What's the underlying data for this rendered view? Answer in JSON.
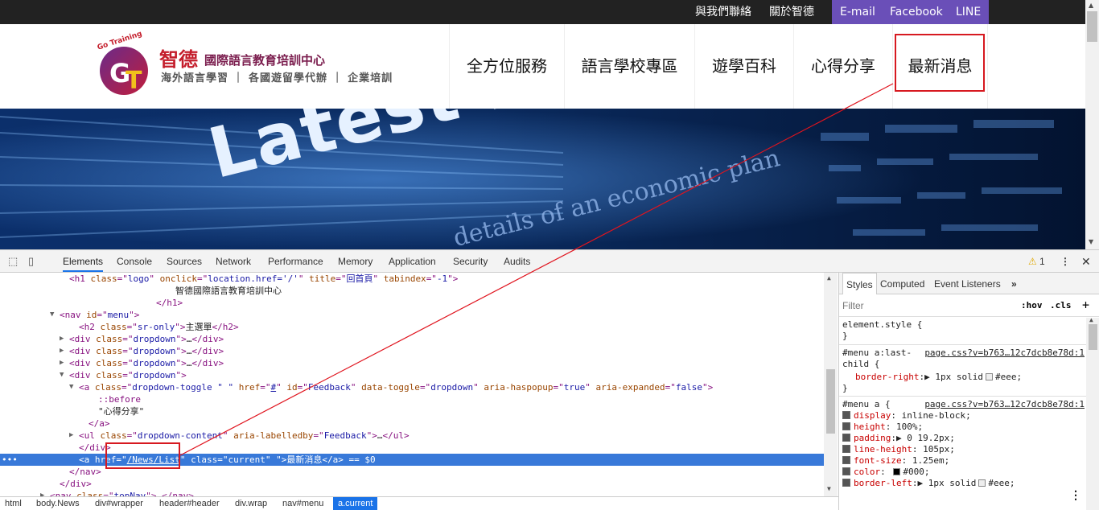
{
  "topbar": {
    "links": [
      "與我們聯絡",
      "關於智德"
    ],
    "social": [
      "E-mail",
      "Facebook",
      "LINE"
    ],
    "colors": {
      "bar": "#222222",
      "social_bg": "#6a4fb8"
    }
  },
  "logo": {
    "badge_text": "Go Training",
    "brand": "智德",
    "org": "國際語言教育培訓中心",
    "tagline": "海外語言學習 ｜ 各國遊留學代辦 ｜ 企業培訓"
  },
  "nav": {
    "items": [
      "全方位服務",
      "語言學校專區",
      "遊學百科",
      "心得分享",
      "最新消息"
    ]
  },
  "banner": {
    "headline": "Latest news",
    "subtext": "details of an economic plan"
  },
  "devtools": {
    "tabs": [
      "Elements",
      "Console",
      "Sources",
      "Network",
      "Performance",
      "Memory",
      "Application",
      "Security",
      "Audits"
    ],
    "active_tab": "Elements",
    "warning_count": "1",
    "dom_lines": [
      {
        "indent": 6,
        "parts": [
          [
            "t",
            "<h1 "
          ],
          [
            "n",
            "class"
          ],
          [
            "t",
            "=\""
          ],
          [
            "v",
            "logo"
          ],
          [
            "t",
            "\" "
          ],
          [
            "n",
            "onclick"
          ],
          [
            "t",
            "=\""
          ],
          [
            "v",
            "location.href='/'"
          ],
          [
            "t",
            "\" "
          ],
          [
            "n",
            "title"
          ],
          [
            "t",
            "=\""
          ],
          [
            "v",
            "回首頁"
          ],
          [
            "t",
            "\" "
          ],
          [
            "n",
            "tabindex"
          ],
          [
            "t",
            "=\""
          ],
          [
            "v",
            "-1"
          ],
          [
            "t",
            "\">"
          ]
        ]
      },
      {
        "indent": 17,
        "parts": [
          [
            "p",
            "智德國際語言教育培訓中心"
          ]
        ]
      },
      {
        "indent": 15,
        "parts": [
          [
            "t",
            "</h1>"
          ]
        ]
      },
      {
        "indent": 5,
        "arrow": "▼",
        "parts": [
          [
            "t",
            "<nav "
          ],
          [
            "n",
            "id"
          ],
          [
            "t",
            "=\""
          ],
          [
            "v",
            "menu"
          ],
          [
            "t",
            "\">"
          ]
        ]
      },
      {
        "indent": 7,
        "parts": [
          [
            "t",
            "<h2 "
          ],
          [
            "n",
            "class"
          ],
          [
            "t",
            "=\""
          ],
          [
            "v",
            "sr-only"
          ],
          [
            "t",
            "\">"
          ],
          [
            "p",
            "主選單"
          ],
          [
            "t",
            "</h2>"
          ]
        ]
      },
      {
        "indent": 6,
        "arrow": "▶",
        "parts": [
          [
            "t",
            "<div "
          ],
          [
            "n",
            "class"
          ],
          [
            "t",
            "=\""
          ],
          [
            "v",
            "dropdown"
          ],
          [
            "t",
            "\">"
          ],
          [
            "p",
            "…"
          ],
          [
            "t",
            "</div>"
          ]
        ]
      },
      {
        "indent": 6,
        "arrow": "▶",
        "parts": [
          [
            "t",
            "<div "
          ],
          [
            "n",
            "class"
          ],
          [
            "t",
            "=\""
          ],
          [
            "v",
            "dropdown"
          ],
          [
            "t",
            "\">"
          ],
          [
            "p",
            "…"
          ],
          [
            "t",
            "</div>"
          ]
        ]
      },
      {
        "indent": 6,
        "arrow": "▶",
        "parts": [
          [
            "t",
            "<div "
          ],
          [
            "n",
            "class"
          ],
          [
            "t",
            "=\""
          ],
          [
            "v",
            "dropdown"
          ],
          [
            "t",
            "\">"
          ],
          [
            "p",
            "…"
          ],
          [
            "t",
            "</div>"
          ]
        ]
      },
      {
        "indent": 6,
        "arrow": "▼",
        "parts": [
          [
            "t",
            "<div "
          ],
          [
            "n",
            "class"
          ],
          [
            "t",
            "=\""
          ],
          [
            "v",
            "dropdown"
          ],
          [
            "t",
            "\">"
          ]
        ]
      },
      {
        "indent": 7,
        "arrow": "▼",
        "parts": [
          [
            "t",
            "<a "
          ],
          [
            "n",
            "class"
          ],
          [
            "t",
            "=\""
          ],
          [
            "v",
            "dropdown-toggle \" \""
          ],
          [
            "t",
            " "
          ],
          [
            "n",
            "href"
          ],
          [
            "t",
            "=\""
          ],
          [
            "v",
            "#"
          ],
          [
            "t",
            "\" "
          ],
          [
            "n",
            "id"
          ],
          [
            "t",
            "=\""
          ],
          [
            "v",
            "Feedback"
          ],
          [
            "t",
            "\" "
          ],
          [
            "n",
            "data-toggle"
          ],
          [
            "t",
            "=\""
          ],
          [
            "v",
            "dropdown"
          ],
          [
            "t",
            "\" "
          ],
          [
            "n",
            "aria-haspopup"
          ],
          [
            "t",
            "=\""
          ],
          [
            "v",
            "true"
          ],
          [
            "t",
            "\" "
          ],
          [
            "n",
            "aria-expanded"
          ],
          [
            "t",
            "=\""
          ],
          [
            "v",
            "false"
          ],
          [
            "t",
            "\">"
          ]
        ]
      },
      {
        "indent": 9,
        "parts": [
          [
            "t",
            "::before"
          ]
        ]
      },
      {
        "indent": 9,
        "parts": [
          [
            "p",
            "\"心得分享\""
          ]
        ]
      },
      {
        "indent": 8,
        "parts": [
          [
            "t",
            "</a>"
          ]
        ]
      },
      {
        "indent": 7,
        "arrow": "▶",
        "parts": [
          [
            "t",
            "<ul "
          ],
          [
            "n",
            "class"
          ],
          [
            "t",
            "=\""
          ],
          [
            "v",
            "dropdown-content"
          ],
          [
            "t",
            "\" "
          ],
          [
            "n",
            "aria-labelledby"
          ],
          [
            "t",
            "=\""
          ],
          [
            "v",
            "Feedback"
          ],
          [
            "t",
            "\">"
          ],
          [
            "p",
            "…"
          ],
          [
            "t",
            "</ul>"
          ]
        ]
      },
      {
        "indent": 7,
        "parts": [
          [
            "t",
            "</div>"
          ]
        ]
      },
      {
        "indent": 7,
        "selected": true,
        "parts": [
          [
            "t",
            "<a "
          ],
          [
            "n",
            "href"
          ],
          [
            "t",
            "=\""
          ],
          [
            "v",
            "/News/List"
          ],
          [
            "t",
            "\" "
          ],
          [
            "n",
            "class"
          ],
          [
            "t",
            "=\""
          ],
          [
            "v",
            "current"
          ],
          [
            "t",
            "\" \">"
          ],
          [
            "p",
            "最新消息"
          ],
          [
            "t",
            "</a>"
          ],
          [
            "p",
            " == $0"
          ]
        ]
      },
      {
        "indent": 6,
        "parts": [
          [
            "t",
            "</nav>"
          ]
        ]
      },
      {
        "indent": 5,
        "parts": [
          [
            "t",
            "</div>"
          ]
        ]
      },
      {
        "indent": 4,
        "arrow": "▶",
        "parts": [
          [
            "t",
            "<nav "
          ],
          [
            "n",
            "class"
          ],
          [
            "t",
            "=\""
          ],
          [
            "v",
            "topNav"
          ],
          [
            "t",
            "\">"
          ],
          [
            "p",
            "…"
          ],
          [
            "t",
            "</nav>"
          ]
        ]
      }
    ],
    "breadcrumbs": [
      "html",
      "body.News",
      "div#wrapper",
      "header#header",
      "div.wrap",
      "nav#menu",
      "a.current"
    ],
    "styles_tabs": [
      "Styles",
      "Computed",
      "Event Listeners"
    ],
    "filter_placeholder": "Filter",
    "hov": ":hov",
    "cls": ".cls",
    "rules": {
      "element_style": "element.style {",
      "close": "}",
      "last_child_selector_1": "#menu a:last-",
      "last_child_selector_2": "child {",
      "last_child_source": "page.css?v=b763…12c7dcb8e78d:1",
      "border_right_prop": "border-right",
      "border_right_val": "1px solid",
      "menu_a_selector": "#menu a {",
      "menu_a_source": "page.css?v=b763…12c7dcb8e78d:1",
      "decls": [
        {
          "p": "display",
          "v": "inline-block;"
        },
        {
          "p": "height",
          "v": "100%;"
        },
        {
          "p": "padding",
          "v": "0 19.2px;",
          "arrow": true
        },
        {
          "p": "line-height",
          "v": "105px;"
        },
        {
          "p": "font-size",
          "v": "1.25em;"
        },
        {
          "p": "color",
          "v": "#000;",
          "swatch": "#000000"
        },
        {
          "p": "border-left",
          "v": "1px solid",
          "arrow": true,
          "swatch2": "#eeeeee",
          "v2": "#eee;"
        }
      ],
      "eee": "#eee;"
    }
  }
}
